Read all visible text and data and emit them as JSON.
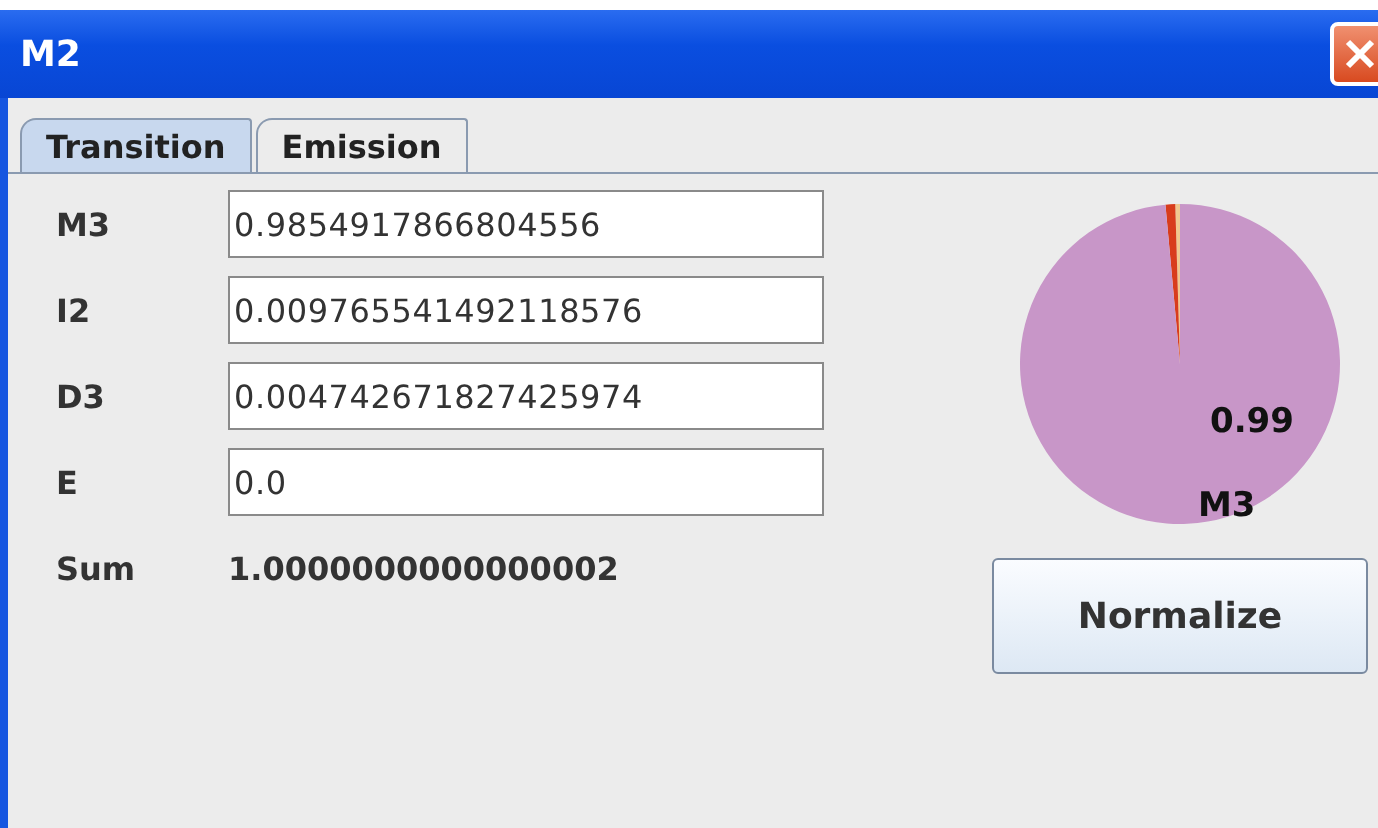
{
  "window": {
    "title": "M2"
  },
  "tabs": [
    {
      "label": "Transition",
      "selected": true
    },
    {
      "label": "Emission",
      "selected": false
    }
  ],
  "fields": [
    {
      "label": "M3",
      "value": "0.9854917866804556"
    },
    {
      "label": "I2",
      "value": "0.009765541492118576"
    },
    {
      "label": "D3",
      "value": "0.004742671827425974"
    },
    {
      "label": "E",
      "value": "0.0"
    }
  ],
  "sum": {
    "label": "Sum",
    "value": "1.0000000000000002"
  },
  "chart_data": {
    "type": "pie",
    "values": [
      0.9854917866804556,
      0.009765541492118576,
      0.004742671827425974,
      0.0
    ],
    "colors": [
      "#c896c8",
      "#d83c1c",
      "#f0c890",
      "#ffffff"
    ],
    "annotations": [
      "0.99",
      "M3"
    ]
  },
  "buttons": [
    {
      "label": "Normalize"
    }
  ]
}
